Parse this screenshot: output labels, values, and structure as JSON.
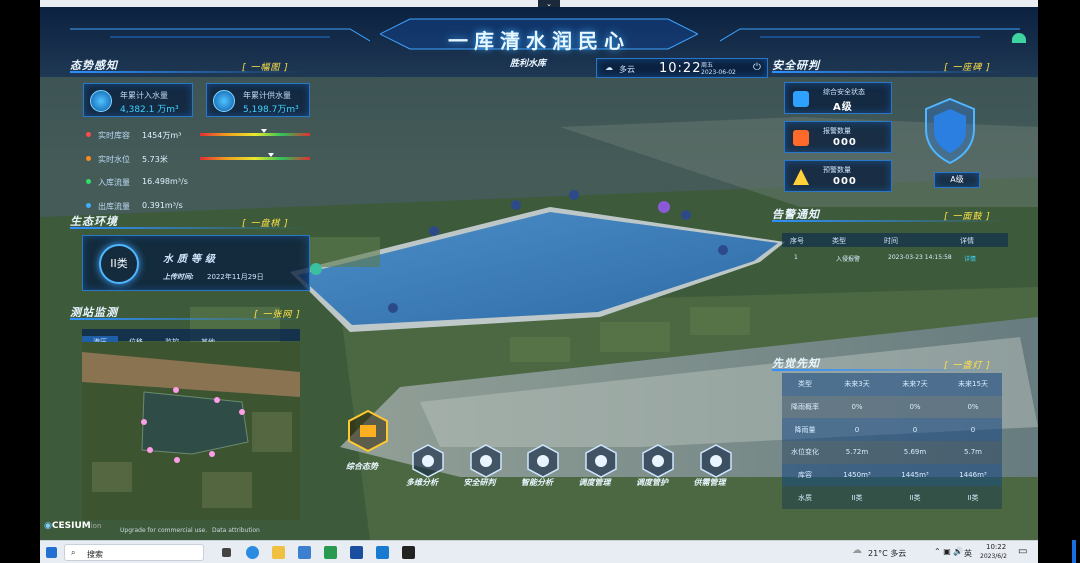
{
  "header": {
    "title": "一库清水润民心",
    "location": "胜利水库",
    "weather": "多云",
    "time": "10:22",
    "weekday": "周五",
    "date": "2023-06-02"
  },
  "situation": {
    "title": "态势感知",
    "tag": "[ 一幅图 ]",
    "cards": [
      {
        "label": "年累计入水量",
        "value": "4,382.1 万m³"
      },
      {
        "label": "年累计供水量",
        "value": "5,198.7万m³"
      }
    ],
    "metrics": [
      {
        "label": "实时库容",
        "value": "1454万m³",
        "color": "#ff4b4b"
      },
      {
        "label": "实时水位",
        "value": "5.73米",
        "color": "#ff8c1a"
      },
      {
        "label": "入库流量",
        "value": "16.498m³/s",
        "color": "#2ee06a"
      },
      {
        "label": "出库流量",
        "value": "0.391m³/s",
        "color": "#3fb0ff"
      }
    ]
  },
  "ecology": {
    "title": "生态环境",
    "tag": "[ 一盘棋 ]",
    "grade": "II类",
    "grade_label": "水质等级",
    "upload_label": "上传时间:",
    "upload_time": "2022年11月29日"
  },
  "monitor": {
    "title": "测站监测",
    "tag": "[ 一张网 ]",
    "tabs": [
      "渗压",
      "位移",
      "监控",
      "其他"
    ]
  },
  "safety": {
    "title": "安全研判",
    "tag": "[ 一座碑 ]",
    "items": [
      {
        "label": "综合安全状态",
        "value": "A级"
      },
      {
        "label": "报警数量",
        "value": "000"
      },
      {
        "label": "预警数量",
        "value": "000"
      }
    ],
    "shield_grade": "A级"
  },
  "alarm": {
    "title": "告警通知",
    "tag": "[ 一面鼓 ]",
    "columns": [
      "序号",
      "类型",
      "时间",
      "详情"
    ],
    "rows": [
      {
        "no": "1",
        "type": "入侵报警",
        "time": "2023-03-23 14:15:58",
        "detail": "详情"
      }
    ]
  },
  "forecast": {
    "title": "先觉先知",
    "tag": "[ 一盏灯 ]",
    "rows": [
      [
        "类型",
        "未来3天",
        "未来7天",
        "未来15天"
      ],
      [
        "降雨概率",
        "0%",
        "0%",
        "0%"
      ],
      [
        "降雨量",
        "0",
        "0",
        "0"
      ],
      [
        "水位变化",
        "5.72m",
        "5.69m",
        "5.7m"
      ],
      [
        "库容",
        "1450m³",
        "1445m³",
        "1446m³"
      ],
      [
        "水质",
        "II类",
        "II类",
        "II类"
      ]
    ]
  },
  "modules": {
    "main": "综合态势",
    "items": [
      "多维分析",
      "安全研判",
      "智能分析",
      "调度管理",
      "调度管护",
      "供需管理"
    ]
  },
  "cesium": {
    "logo": "CESIUM",
    "logo_suffix": "ion",
    "notice": "Upgrade for commercial use.",
    "attribution": "Data attribution"
  },
  "taskbar": {
    "search": "搜索",
    "weather": "21°C 多云",
    "lang": "英",
    "time": "10:22",
    "date": "2023/6/2"
  }
}
